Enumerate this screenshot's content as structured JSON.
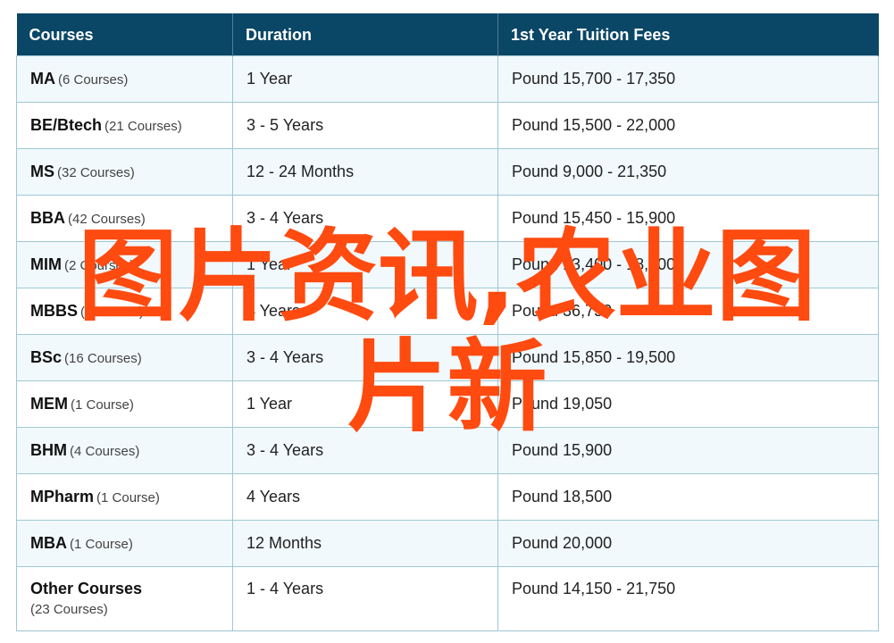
{
  "table": {
    "headers": [
      "Courses",
      "Duration",
      "1st Year Tuition Fees"
    ],
    "rows": [
      {
        "course": "MA",
        "count": "(6 Courses)",
        "duration": "1 Year",
        "fee": "Pound 15,700 - 17,350"
      },
      {
        "course": "BE/Btech",
        "count": "(21 Courses)",
        "duration": "3 - 5 Years",
        "fee": "Pound 15,500 - 22,000"
      },
      {
        "course": "MS",
        "count": "(32 Courses)",
        "duration": "12 - 24 Months",
        "fee": "Pound 9,000 - 21,350"
      },
      {
        "course": "BBA",
        "count": "(42 Courses)",
        "duration": "3 - 4 Years",
        "fee": "Pound 15,450 - 15,900"
      },
      {
        "course": "MIM",
        "count": "(2 Courses)",
        "duration": "1 Year",
        "fee": "Pound 13,400 - 18,900"
      },
      {
        "course": "MBBS",
        "count": "(1 Course)",
        "duration": "4 Years",
        "fee": "Pound 36,750"
      },
      {
        "course": "BSc",
        "count": "(16 Courses)",
        "duration": "3 - 4 Years",
        "fee": "Pound 15,850 - 19,500"
      },
      {
        "course": "MEM",
        "count": "(1 Course)",
        "duration": "1 Year",
        "fee": "Pound 19,050"
      },
      {
        "course": "BHM",
        "count": "(4 Courses)",
        "duration": "3 - 4 Years",
        "fee": "Pound 15,900"
      },
      {
        "course": "MPharm",
        "count": "(1 Course)",
        "duration": "4 Years",
        "fee": "Pound 18,500"
      },
      {
        "course": "MBA",
        "count": "(1 Course)",
        "duration": "12 Months",
        "fee": "Pound 20,000"
      },
      {
        "course": "Other Courses",
        "count": "(23 Courses)",
        "duration": "1 - 4 Years",
        "fee": "Pound 14,150 - 21,750"
      }
    ]
  },
  "watermark": {
    "line1": "图片资讯,农业图",
    "line2": "片新"
  },
  "colors": {
    "header_bg": "#0a4666",
    "row_alt_bg": "#f1f9fc",
    "border": "#9fc7d3",
    "watermark": "#ff4a10"
  }
}
